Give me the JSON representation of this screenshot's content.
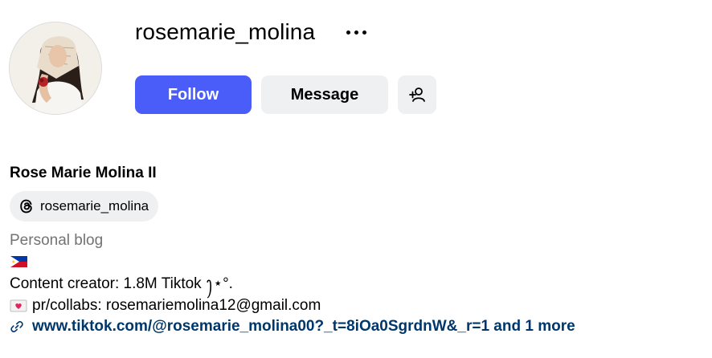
{
  "profile": {
    "username": "rosemarie_molina",
    "full_name": "Rose Marie Molina II",
    "threads_handle": "rosemarie_molina",
    "category": "Personal blog",
    "flag_emoji": "🇵🇭",
    "bio_lines": [
      "Content creator: 1.8M Tiktok ꫂ⋆°.",
      "pr/collabs: rosemariemolina12@gmail.com"
    ],
    "bio_line2_emoji": "💌",
    "link_text": "www.tiktok.com/@rosemarie_molina00?_t=8iOa0SgrdnW&_r=1 and 1 more"
  },
  "buttons": {
    "follow_label": "Follow",
    "message_label": "Message"
  },
  "icons": {
    "more": "more-horizontal-icon",
    "add_user": "person-add-icon",
    "threads": "threads-icon",
    "link": "link-icon"
  },
  "colors": {
    "follow_bg": "#4a5df9",
    "button_secondary_bg": "#eff0f2",
    "category_text": "#737373",
    "link_text": "#00376b"
  }
}
